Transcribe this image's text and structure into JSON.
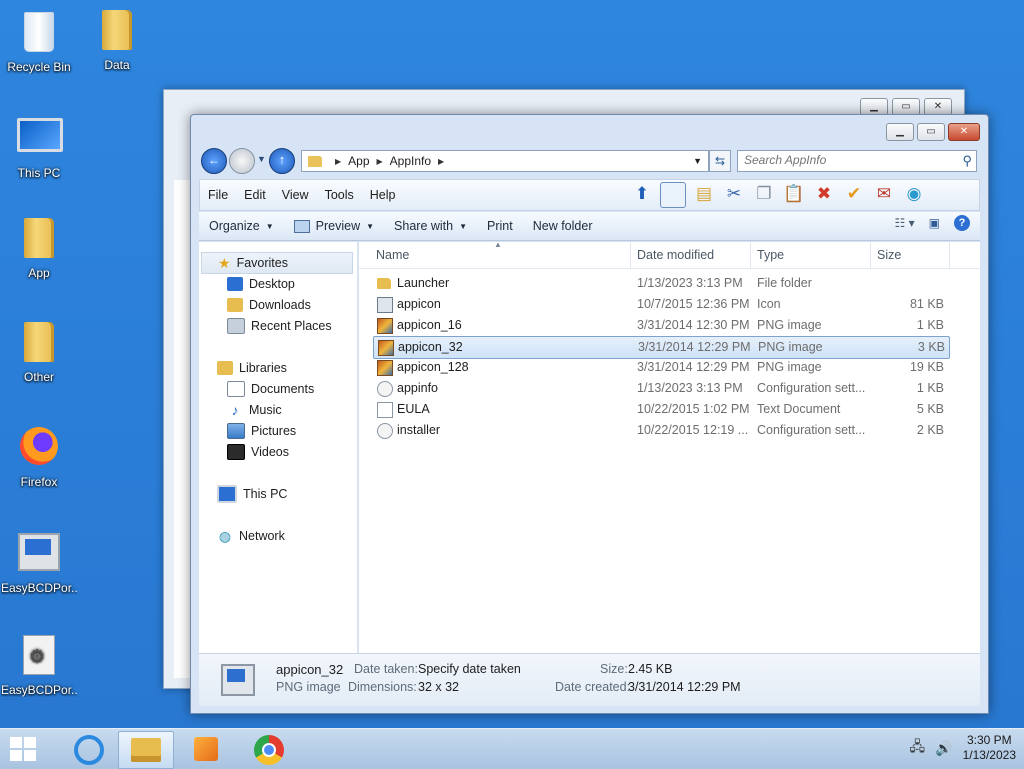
{
  "desktop": {
    "icons": [
      {
        "label": "Recycle Bin"
      },
      {
        "label": "Data"
      },
      {
        "label": "This PC"
      },
      {
        "label": "App"
      },
      {
        "label": "Other"
      },
      {
        "label": "Firefox"
      },
      {
        "label": "EasyBCDPor..."
      },
      {
        "label": "EasyBCDPor..."
      }
    ]
  },
  "window": {
    "breadcrumb": [
      "App",
      "AppInfo"
    ],
    "search_placeholder": "Search AppInfo",
    "menu": [
      "File",
      "Edit",
      "View",
      "Tools",
      "Help"
    ],
    "commands": {
      "organize": "Organize",
      "preview": "Preview",
      "share_with": "Share with",
      "print": "Print",
      "new_folder": "New folder"
    },
    "nav": {
      "favorites": "Favorites",
      "desktop": "Desktop",
      "downloads": "Downloads",
      "recent_places": "Recent Places",
      "libraries": "Libraries",
      "documents": "Documents",
      "music": "Music",
      "pictures": "Pictures",
      "videos": "Videos",
      "this_pc": "This PC",
      "network": "Network"
    },
    "columns": {
      "name": "Name",
      "date_modified": "Date modified",
      "type": "Type",
      "size": "Size"
    },
    "files": [
      {
        "name": "Launcher",
        "date": "1/13/2023 3:13 PM",
        "type": "File folder",
        "size": "",
        "icon": "folder"
      },
      {
        "name": "appicon",
        "date": "10/7/2015 12:36 PM",
        "type": "Icon",
        "size": "81 KB",
        "icon": "icon-file"
      },
      {
        "name": "appicon_16",
        "date": "3/31/2014 12:30 PM",
        "type": "PNG image",
        "size": "1 KB",
        "icon": "png"
      },
      {
        "name": "appicon_32",
        "date": "3/31/2014 12:29 PM",
        "type": "PNG image",
        "size": "3 KB",
        "icon": "png",
        "selected": true
      },
      {
        "name": "appicon_128",
        "date": "3/31/2014 12:29 PM",
        "type": "PNG image",
        "size": "19 KB",
        "icon": "png"
      },
      {
        "name": "appinfo",
        "date": "1/13/2023 3:13 PM",
        "type": "Configuration sett...",
        "size": "1 KB",
        "icon": "config"
      },
      {
        "name": "EULA",
        "date": "10/22/2015 1:02 PM",
        "type": "Text Document",
        "size": "5 KB",
        "icon": "text"
      },
      {
        "name": "installer",
        "date": "10/22/2015 12:19 ...",
        "type": "Configuration sett...",
        "size": "2 KB",
        "icon": "config"
      }
    ],
    "details": {
      "name": "appicon_32",
      "kind": "PNG image",
      "date_taken_label": "Date taken:",
      "date_taken_value": "Specify date taken",
      "dimensions_label": "Dimensions:",
      "dimensions_value": "32 x 32",
      "size_label": "Size:",
      "size_value": "2.45 KB",
      "date_created_label": "Date created:",
      "date_created_value": "3/31/2014 12:29 PM"
    }
  },
  "taskbar": {
    "time": "3:30 PM",
    "date": "1/13/2023"
  }
}
